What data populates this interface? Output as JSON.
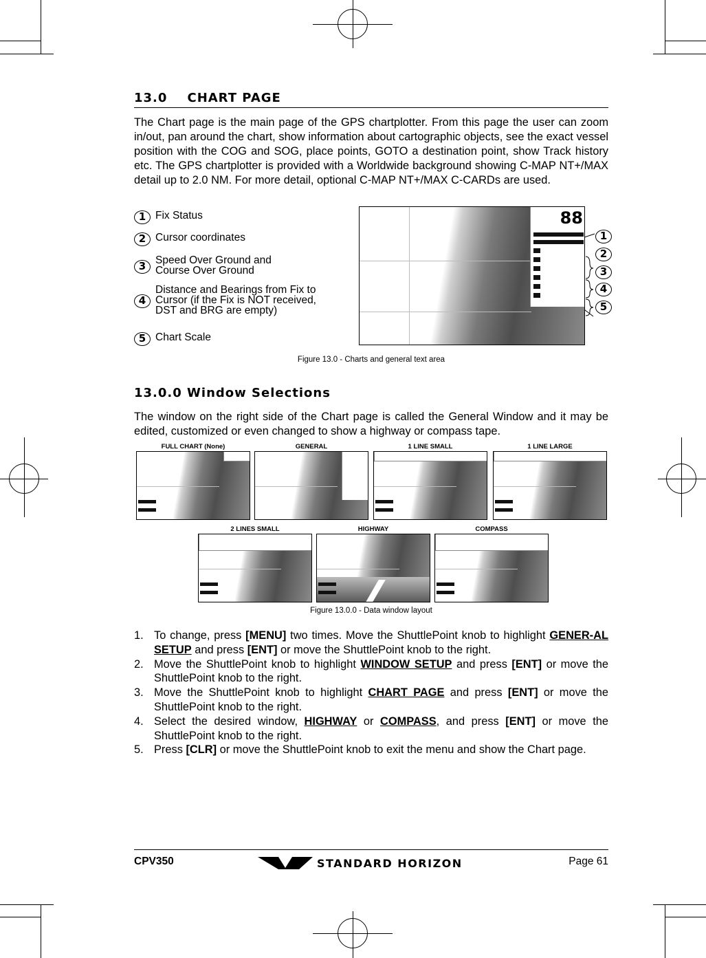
{
  "section": {
    "title": "13.0    CHART PAGE",
    "intro": "The Chart page is the main page of the GPS chartplotter. From this page the user can zoom in/out, pan around the chart, show information about cartographic objects, see the exact vessel position with the COG and SOG, place points, GOTO a destination point, show Track history etc. The GPS chartplotter is provided with a Worldwide background showing C-MAP NT+/MAX detail up to 2.0 NM. For more detail, optional C-MAP NT+/MAX C-CARDs are used."
  },
  "features": [
    {
      "n": "1",
      "label": "Fix Status"
    },
    {
      "n": "2",
      "label": "Cursor coordinates"
    },
    {
      "n": "3",
      "label": "Speed Over Ground and\nCourse Over Ground"
    },
    {
      "n": "4",
      "label": "Distance and Bearings from Fix to\nCursor (if the Fix is NOT received,\nDST and BRG are empty)"
    },
    {
      "n": "5",
      "label": "Chart Scale"
    }
  ],
  "figure1": {
    "caption": "Figure 13.0  - Charts and general text area",
    "display_digits": "88",
    "callouts": [
      "1",
      "2",
      "3",
      "4",
      "5"
    ]
  },
  "subsection": {
    "title": "13.0.0  Window Selections",
    "intro": "The window on the right side of the Chart page is called the General Window and it may be edited, customized or even changed to show a highway or compass tape."
  },
  "thumbnails": [
    "FULL CHART (None)",
    "GENERAL",
    "1 LINE SMALL",
    "1 LINE LARGE",
    "2 LINES SMALL",
    "HIGHWAY",
    "COMPASS"
  ],
  "figure2": {
    "caption": "Figure 13.0.0 - Data window layout"
  },
  "steps": [
    [
      {
        "t": "To change, press "
      },
      {
        "t": "[MENU]",
        "s": "b"
      },
      {
        "t": " two times. Move the ShuttlePoint knob to highlight "
      },
      {
        "t": "GENER-AL SETUP",
        "s": "bu"
      },
      {
        "t": " and press "
      },
      {
        "t": "[ENT]",
        "s": "b"
      },
      {
        "t": " or move the ShuttlePoint knob to the right."
      }
    ],
    [
      {
        "t": "Move the ShuttlePoint knob to highlight "
      },
      {
        "t": "WINDOW SETUP",
        "s": "bu"
      },
      {
        "t": " and press "
      },
      {
        "t": "[ENT]",
        "s": "b"
      },
      {
        "t": " or move the ShuttlePoint knob to the right."
      }
    ],
    [
      {
        "t": "Move the ShuttlePoint knob to highlight "
      },
      {
        "t": "CHART PAGE",
        "s": "bu"
      },
      {
        "t": " and press "
      },
      {
        "t": "[ENT]",
        "s": "b"
      },
      {
        "t": " or move the ShuttlePoint knob to the right."
      }
    ],
    [
      {
        "t": "Select the desired window, "
      },
      {
        "t": "HIGHWAY",
        "s": "bu"
      },
      {
        "t": " or "
      },
      {
        "t": "COMPASS",
        "s": "bu"
      },
      {
        "t": ", and press "
      },
      {
        "t": "[ENT]",
        "s": "b"
      },
      {
        "t": " or move the ShuttlePoint knob to the right."
      }
    ],
    [
      {
        "t": "Press "
      },
      {
        "t": "[CLR]",
        "s": "b"
      },
      {
        "t": " or move the ShuttlePoint knob to exit the menu and show the Chart page."
      }
    ]
  ],
  "footer": {
    "model": "CPV350",
    "brand": "STANDARD HORIZON",
    "page": "Page 61"
  }
}
